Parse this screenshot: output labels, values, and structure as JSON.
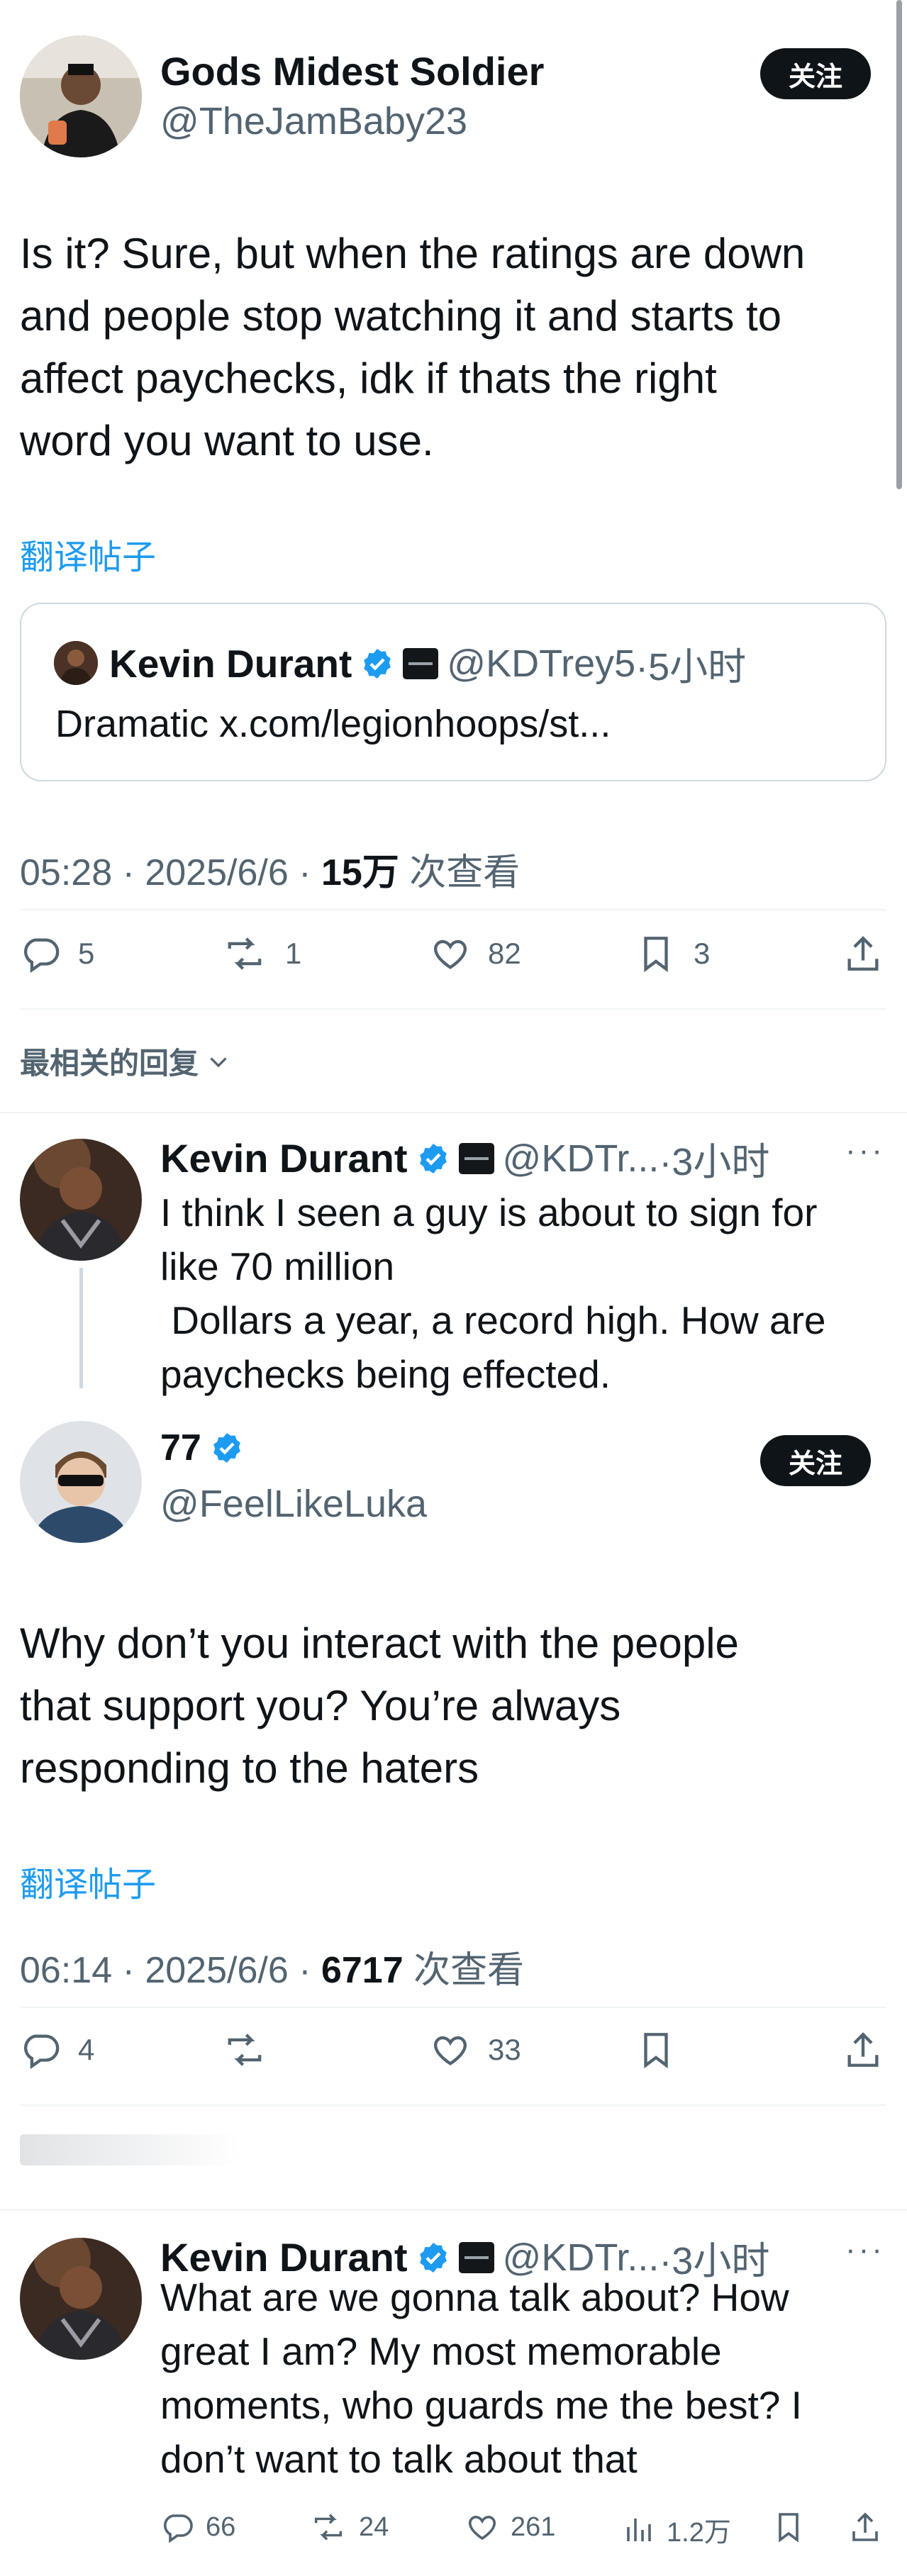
{
  "main_post": {
    "author_name": "Gods Midest Soldier",
    "author_handle": "@TheJamBaby23",
    "follow_label": "关注",
    "text_lines": [
      "Is it? Sure, but when the ratings are down",
      "and people stop watching it and starts to",
      "affect paychecks, idk if thats the right",
      "word you want to use."
    ],
    "translate_label": "翻译帖子",
    "quote": {
      "name": "Kevin Durant",
      "handle": "@KDTrey5",
      "time": "·5小时",
      "text": "Dramatic x.com/legionhoops/st..."
    },
    "time": "05:28 · 2025/6/6 · ",
    "views": "15万",
    "views_label": " 次查看",
    "stats": {
      "replies": "5",
      "reposts": "1",
      "likes": "82",
      "bookmarks": "3"
    }
  },
  "replies_header": "最相关的回复",
  "kd_reply_1": {
    "name": "Kevin Durant",
    "handle": "@KDTr...",
    "time": "·3小时",
    "text_lines": [
      "I think I seen a guy is about to sign for",
      "like 70 million",
      " Dollars a year, a record high. How are",
      "paychecks being effected."
    ]
  },
  "post_77": {
    "author_name": "77",
    "author_handle": "@FeelLikeLuka",
    "follow_label": "关注",
    "text_lines": [
      "Why don’t you interact with the people",
      "that support you? You’re always",
      "responding to the haters"
    ],
    "translate_label": "翻译帖子",
    "time": "06:14 · 2025/6/6 · ",
    "views": "6717",
    "views_label": " 次查看",
    "stats": {
      "replies": "4",
      "reposts": "",
      "likes": "33"
    }
  },
  "kd_reply_2": {
    "name": "Kevin Durant",
    "handle": "@KDTr...",
    "time": "·3小时",
    "text_lines": [
      "What are we gonna talk about? How",
      "great I am? My most memorable",
      "moments, who guards me the best? I",
      "don’t want to talk about that"
    ],
    "stats": {
      "replies": "66",
      "reposts": "24",
      "likes": "261",
      "views": "1.2万"
    }
  },
  "colors": {
    "text": "#0f1419",
    "secondary": "#536471",
    "link": "#1d9bf0",
    "verified": "#1d9bf0",
    "follow_bg": "#0f1419"
  }
}
